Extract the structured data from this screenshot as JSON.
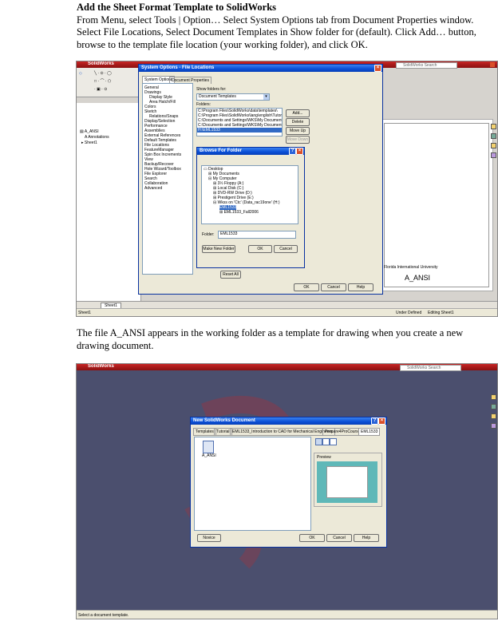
{
  "heading": "Add the Sheet Format Template to SolidWorks",
  "instructions": "From Menu, select Tools | Option… Select System Options tab from Document Properties window. Select File Locations, Select Document Templates in Show folder for (default). Click Add… button, browse to the template file location (your working folder), and click OK.",
  "caption": "The file A_ANSI appears in the working folder as a template for drawing when you create a new drawing document.",
  "screen1": {
    "app_title": "SolidWorks",
    "search_placeholder": "SolidWorks Search",
    "dialog_title": "System Options - File Locations",
    "tabs": [
      "System Options",
      "Document Properties"
    ],
    "categories": [
      "General",
      "Drawings",
      "Display Style",
      "Area Hatch/Fill",
      "Colors",
      "Sketch",
      "Relations/Snaps",
      "Display/Selection",
      "Performance",
      "Assemblies",
      "External References",
      "Default Templates",
      "File Locations",
      "FeatureManager",
      "Spin Box Increments",
      "View",
      "Backup/Recover",
      "Hole Wizard/Toolbox",
      "File Explorer",
      "Search",
      "Collaboration",
      "Advanced"
    ],
    "show_folders_label": "Show folders for:",
    "show_folders_value": "Document Templates",
    "folders_label": "Folders:",
    "folders": [
      "C:\\Program Files\\SolidWorks\\data\\templates\\",
      "C:\\Program Files\\SolidWorks\\lang\\english\\Tutorial",
      "C:\\Documents and Settings\\WKS\\My Documents\\Ly",
      "C:\\Documents and Settings\\WKS\\My Documents\\Ly",
      "H:\\EML1533"
    ],
    "side_buttons": [
      "Add...",
      "Delete",
      "Move Up",
      "Move Down"
    ],
    "reset_label": "Reset All",
    "ok_label": "OK",
    "cancel_label": "Cancel",
    "help_label": "Help",
    "tree_items": [
      "A_ANSI",
      "Annotations",
      "Sheet1"
    ],
    "sheet_tab": "Sheet1",
    "status_left": "Sheet1",
    "status_right": [
      "Under Defined",
      "Editing Sheet1"
    ],
    "browse": {
      "title": "Browse For Folder",
      "items": [
        "Desktop",
        "My Documents",
        "My Computer",
        "3½ Floppy (A:)",
        "Local Disk (C:)",
        "DVD-RW Drive (D:)",
        "Prestigent Drive (E:)",
        "Wkss on 'Ctc' (Data_rac19one' (H:)",
        "EML1533",
        "EML1533_Fall2006"
      ],
      "folder_label": "Folder:",
      "folder_value": "EML1533",
      "make_new_label": "Make New Folder",
      "ok_label": "OK",
      "cancel_label": "Cancel"
    },
    "sheet_text": "Florida International University",
    "sheet_name": "A_ANSI"
  },
  "screen2": {
    "app_title": "SolidWorks",
    "search_placeholder": "SolidWorks Search",
    "dialog_title": "New SolidWorks Document",
    "tabs": [
      "Templates",
      "Tutorial",
      "EML1533_Introduction to CAD for Mechanical Engineers",
      "Prepare4ProCourse",
      "EML1533"
    ],
    "file_name": "A_ANSI",
    "preview_label": "Preview",
    "novice_label": "Novice",
    "ok_label": "OK",
    "cancel_label": "Cancel",
    "help_label": "Help",
    "status_text": "Select a document template."
  },
  "colors": {
    "xp_blue": "#0a4fd6",
    "solidworks_red": "#b01818",
    "dialog_face": "#ece9d8",
    "preview_teal": "#5fb8b8"
  }
}
